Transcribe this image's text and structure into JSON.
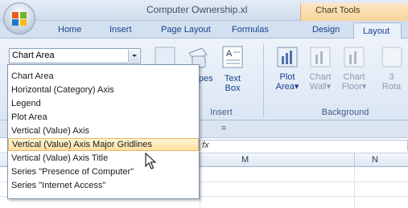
{
  "window": {
    "title": "Computer Ownership.xl",
    "context_group": "Chart Tools"
  },
  "tabs": [
    "Home",
    "Insert",
    "Page Layout",
    "Formulas",
    "Design",
    "Layout"
  ],
  "active_tab": "Layout",
  "selection_box": {
    "value": "Chart Area"
  },
  "ribbon": {
    "insert_group": {
      "label": "Insert",
      "shapes_label": "Shapes",
      "text_box_line1": "Text",
      "text_box_line2": "Box"
    },
    "background_group": {
      "label": "Background",
      "plot_area_line1": "Plot",
      "plot_area_line2": "Area",
      "chart_wall_line1": "Chart",
      "chart_wall_line2": "Wall",
      "chart_floor_line1": "Chart",
      "chart_floor_line2": "Floor",
      "rotation_line1": "3",
      "rotation_line2": "Rota"
    }
  },
  "formula_bar": {
    "equals": "="
  },
  "columns": [
    "M",
    "N"
  ],
  "dropdown_items": [
    "Chart Area",
    "Horizontal (Category) Axis",
    "Legend",
    "Plot Area",
    "Vertical (Value) Axis",
    "Vertical (Value) Axis Major Gridlines",
    "Vertical (Value) Axis Title",
    "Series \"Presence of Computer\"",
    "Series \"Internet Access\""
  ],
  "highlighted_item_index": 5,
  "colors": {
    "highlight": "#ffe0a0",
    "ribbon": "#dbe6f4",
    "text": "#15428b"
  }
}
